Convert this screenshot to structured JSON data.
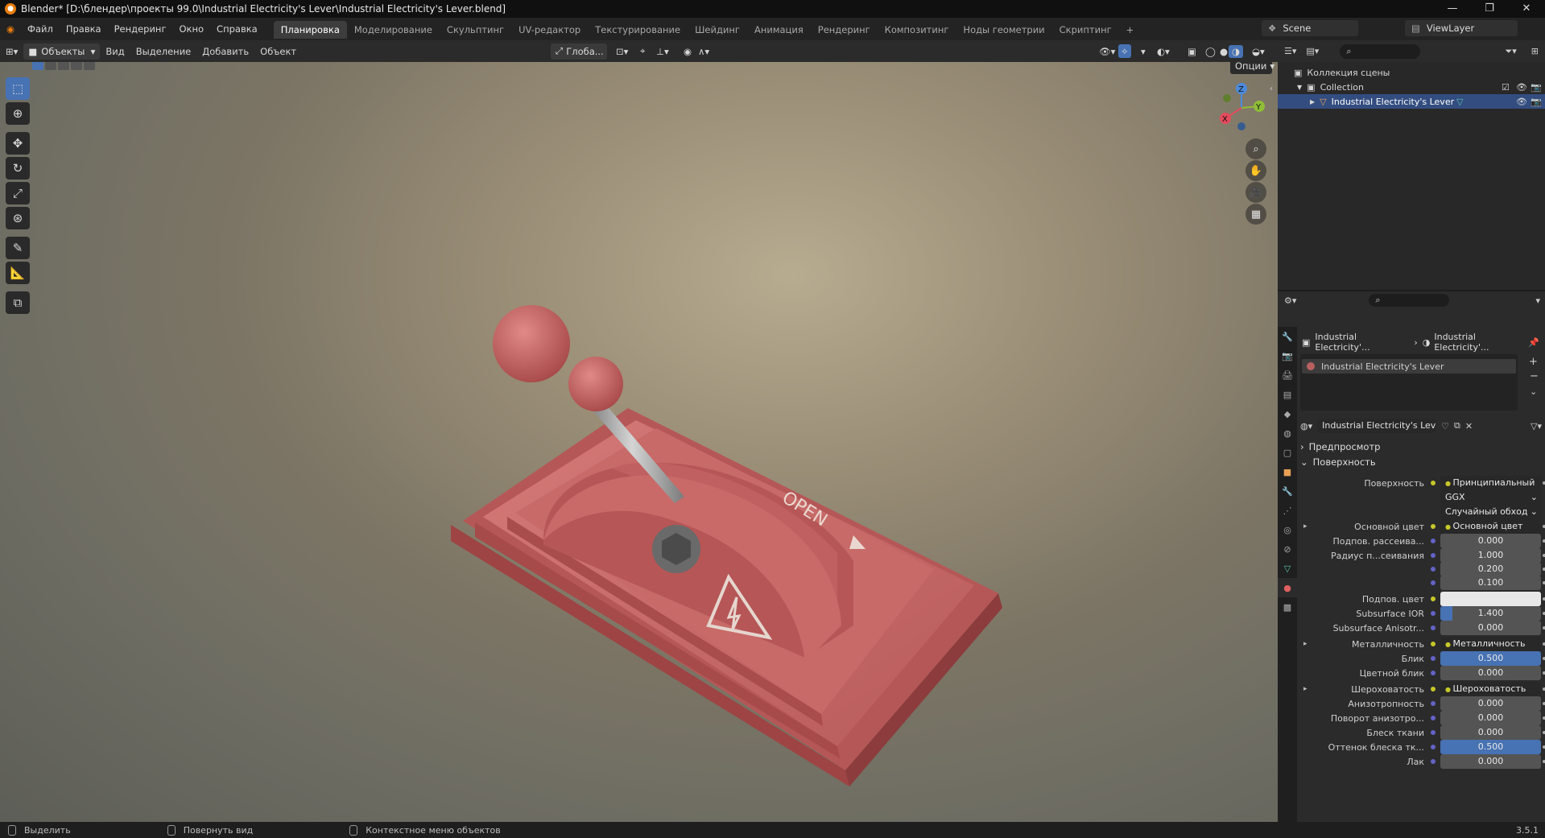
{
  "title": "Blender* [D:\\блендер\\проекты 99.0\\Industrial Electricity's Lever\\Industrial Electricity's Lever.blend]",
  "window_controls": [
    "—",
    "❐",
    "✕"
  ],
  "menu": [
    "Файл",
    "Правка",
    "Рендеринг",
    "Окно",
    "Справка"
  ],
  "workspaces": [
    "Планировка",
    "Моделирование",
    "Скульптинг",
    "UV-редактор",
    "Текстурирование",
    "Шейдинг",
    "Анимация",
    "Рендеринг",
    "Композитинг",
    "Ноды геометрии",
    "Скриптинг"
  ],
  "scene": "Scene",
  "view_layer": "ViewLayer",
  "viewport_header": {
    "mode": "Объекты",
    "menus": [
      "Вид",
      "Выделение",
      "Добавить",
      "Объект"
    ],
    "orientation": "Глоба...",
    "options": "Опции"
  },
  "gizmo": {
    "x": "X",
    "y": "Y",
    "z": "Z"
  },
  "model_text": "OPEN",
  "outliner": {
    "root": "Коллекция сцены",
    "collection": "Collection",
    "object": "Industrial Electricity's Lever"
  },
  "properties": {
    "breadcrumb_obj": "Industrial Electricity'...",
    "breadcrumb_mat": "Industrial Electricity'...",
    "slot": "Industrial Electricity's Lever",
    "material_name": "Industrial Electricity's Lever",
    "sections": {
      "preview": "Предпросмотр",
      "surface": "Поверхность"
    },
    "rows": [
      {
        "label": "Поверхность",
        "value": "Принципиальный BSDF",
        "kind": "node"
      },
      {
        "label": "",
        "value": "GGX",
        "kind": "dropdown"
      },
      {
        "label": "",
        "value": "Случайный обход",
        "kind": "dropdown"
      },
      {
        "label": "Основной цвет",
        "value": "Основной цвет",
        "kind": "node"
      },
      {
        "label": "Подпов. рассеива...",
        "value": "0.000",
        "kind": "num"
      },
      {
        "label": "Радиус п...сеивания",
        "value": "1.000",
        "kind": "num"
      },
      {
        "label": "",
        "value": "0.200",
        "kind": "num"
      },
      {
        "label": "",
        "value": "0.100",
        "kind": "num"
      },
      {
        "label": "Подпов. цвет",
        "value": "",
        "kind": "color"
      },
      {
        "label": "Subsurface IOR",
        "value": "1.400",
        "kind": "num"
      },
      {
        "label": "Subsurface Anisotr...",
        "value": "0.000",
        "kind": "num"
      },
      {
        "label": "Металличность",
        "value": "Металличность",
        "kind": "node"
      },
      {
        "label": "Блик",
        "value": "0.500",
        "kind": "num"
      },
      {
        "label": "Цветной блик",
        "value": "0.000",
        "kind": "num"
      },
      {
        "label": "Шероховатость",
        "value": "Шероховатость",
        "kind": "node"
      },
      {
        "label": "Анизотропность",
        "value": "0.000",
        "kind": "num"
      },
      {
        "label": "Поворот анизотро...",
        "value": "0.000",
        "kind": "num"
      },
      {
        "label": "Блеск ткани",
        "value": "0.000",
        "kind": "num"
      },
      {
        "label": "Оттенок блеска тк...",
        "value": "0.500",
        "kind": "num"
      },
      {
        "label": "Лак",
        "value": "0.000",
        "kind": "num"
      }
    ]
  },
  "status": {
    "select": "Выделить",
    "rotate": "Повернуть вид",
    "context": "Контекстное меню объектов",
    "version": "3.5.1"
  },
  "colors": {
    "accent": "#4772b3",
    "model": "#c45555",
    "bg": "#1d1d1d"
  }
}
